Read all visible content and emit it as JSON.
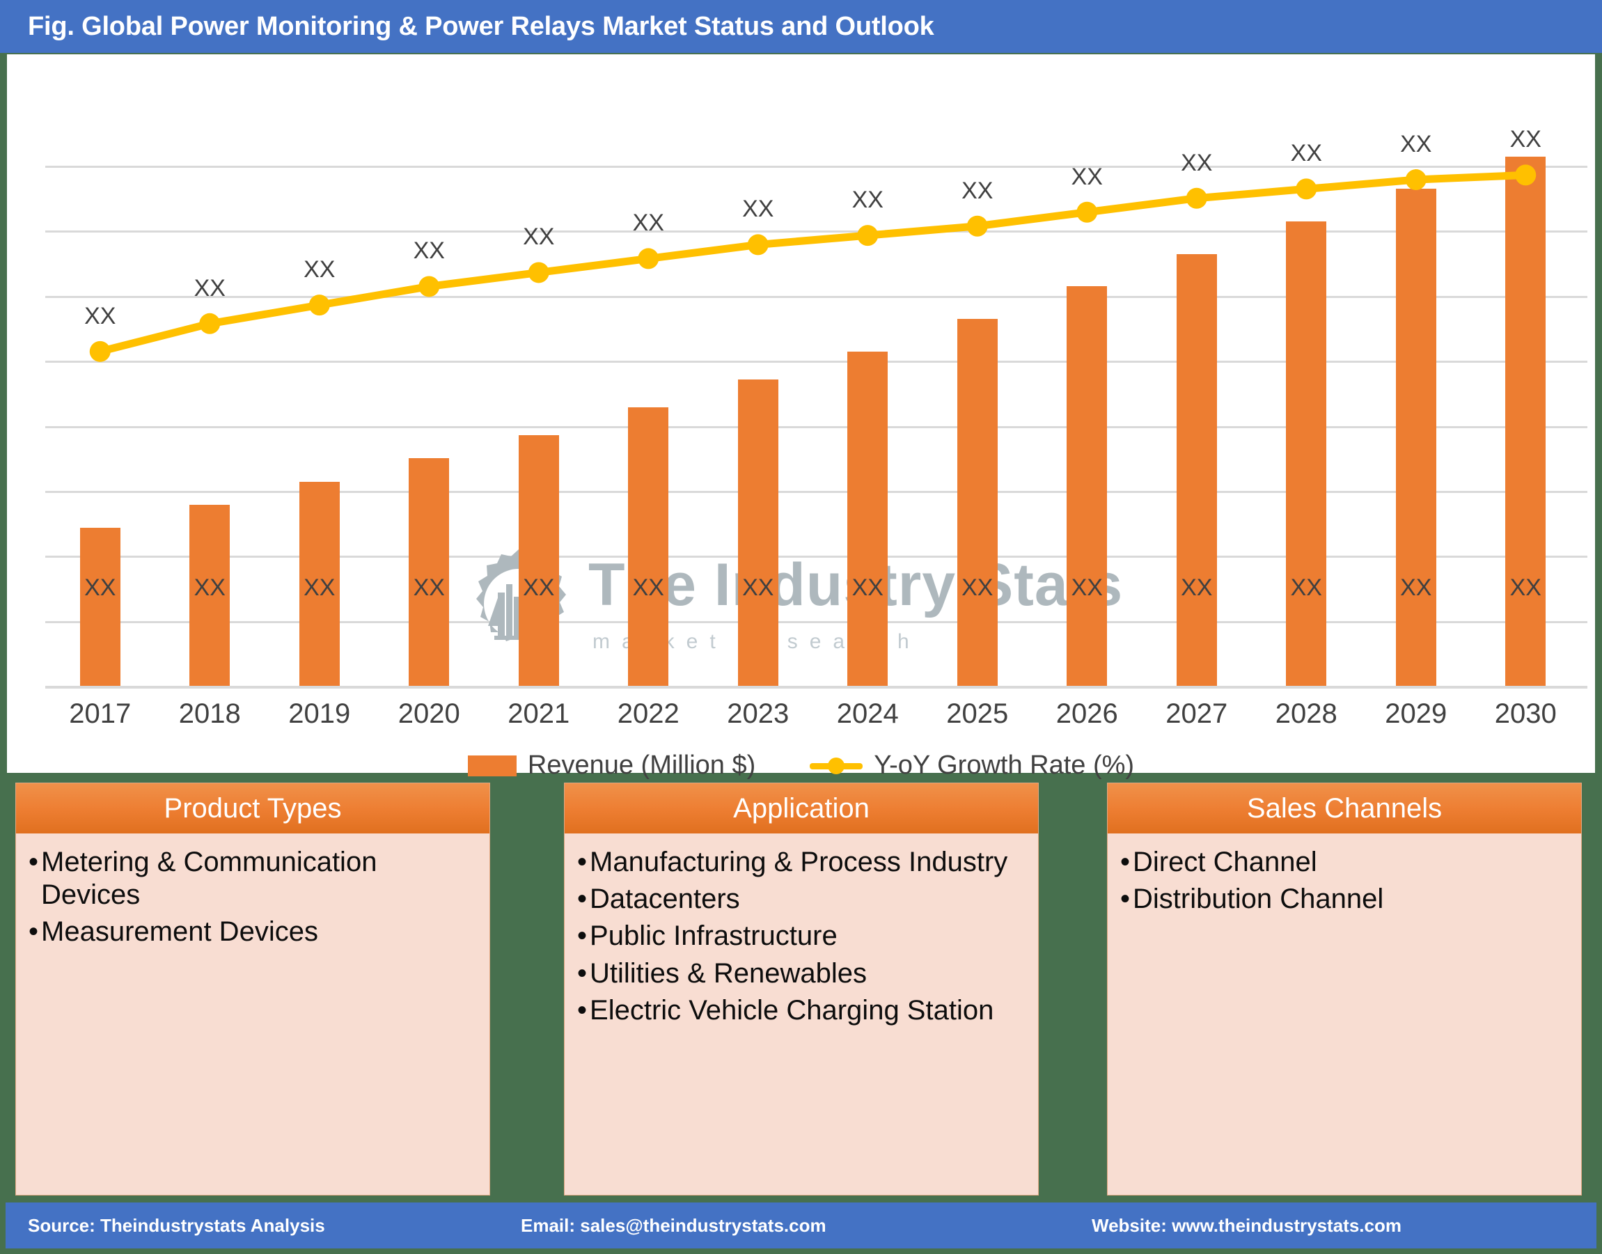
{
  "header": {
    "title": "Fig. Global Power Monitoring & Power Relays Market Status and Outlook"
  },
  "watermark": {
    "brand": "The Industry Stats",
    "tagline": "m a r k e t   r e s e a r c h",
    "logo_icon": "gear-factory-wrench-logo-icon"
  },
  "legend": {
    "bar_label": "Revenue (Million $)",
    "line_label": "Y-oY Growth Rate (%)"
  },
  "chart_data": {
    "type": "bar",
    "title": "Fig. Global Power Monitoring & Power Relays Market Status and Outlook",
    "xlabel": "",
    "ylabel": "",
    "grid": true,
    "legend_position": "bottom",
    "categories": [
      "2017",
      "2018",
      "2019",
      "2020",
      "2021",
      "2022",
      "2023",
      "2024",
      "2025",
      "2026",
      "2027",
      "2028",
      "2029",
      "2030"
    ],
    "series": [
      {
        "name": "Revenue (Million $)",
        "type": "bar",
        "color": "#ED7D31",
        "value_labels": [
          "XX",
          "XX",
          "XX",
          "XX",
          "XX",
          "XX",
          "XX",
          "XX",
          "XX",
          "XX",
          "XX",
          "XX",
          "XX",
          "XX"
        ],
        "values": [
          34,
          39,
          44,
          49,
          54,
          60,
          66,
          72,
          79,
          86,
          93,
          100,
          107,
          114
        ]
      },
      {
        "name": "Y-oY Growth Rate (%)",
        "type": "line",
        "color": "#FFC000",
        "value_labels": [
          "XX",
          "XX",
          "XX",
          "XX",
          "XX",
          "XX",
          "XX",
          "XX",
          "XX",
          "XX",
          "XX",
          "XX",
          "XX",
          "XX"
        ],
        "values": [
          72,
          78,
          82,
          86,
          89,
          92,
          95,
          97,
          99,
          102,
          105,
          107,
          109,
          110
        ]
      }
    ],
    "ylim": [
      0,
      130
    ],
    "gridline_count": 8
  },
  "panels": [
    {
      "title": "Product Types",
      "items": [
        "Metering & Communication Devices",
        "Measurement Devices"
      ]
    },
    {
      "title": "Application",
      "items": [
        "Manufacturing & Process Industry",
        "Datacenters",
        "Public Infrastructure",
        "Utilities & Renewables",
        "Electric Vehicle Charging Station"
      ]
    },
    {
      "title": "Sales Channels",
      "items": [
        "Direct Channel",
        "Distribution Channel"
      ]
    }
  ],
  "footer": {
    "source": "Source: Theindustrystats Analysis",
    "email": "Email: sales@theindustrystats.com",
    "website": "Website: www.theindustrystats.com"
  },
  "colors": {
    "header_blue": "#4472C4",
    "bar_orange": "#ED7D31",
    "line_yellow": "#FFC000",
    "panel_bg": "#F8DDD2",
    "background_green": "#47704E"
  }
}
